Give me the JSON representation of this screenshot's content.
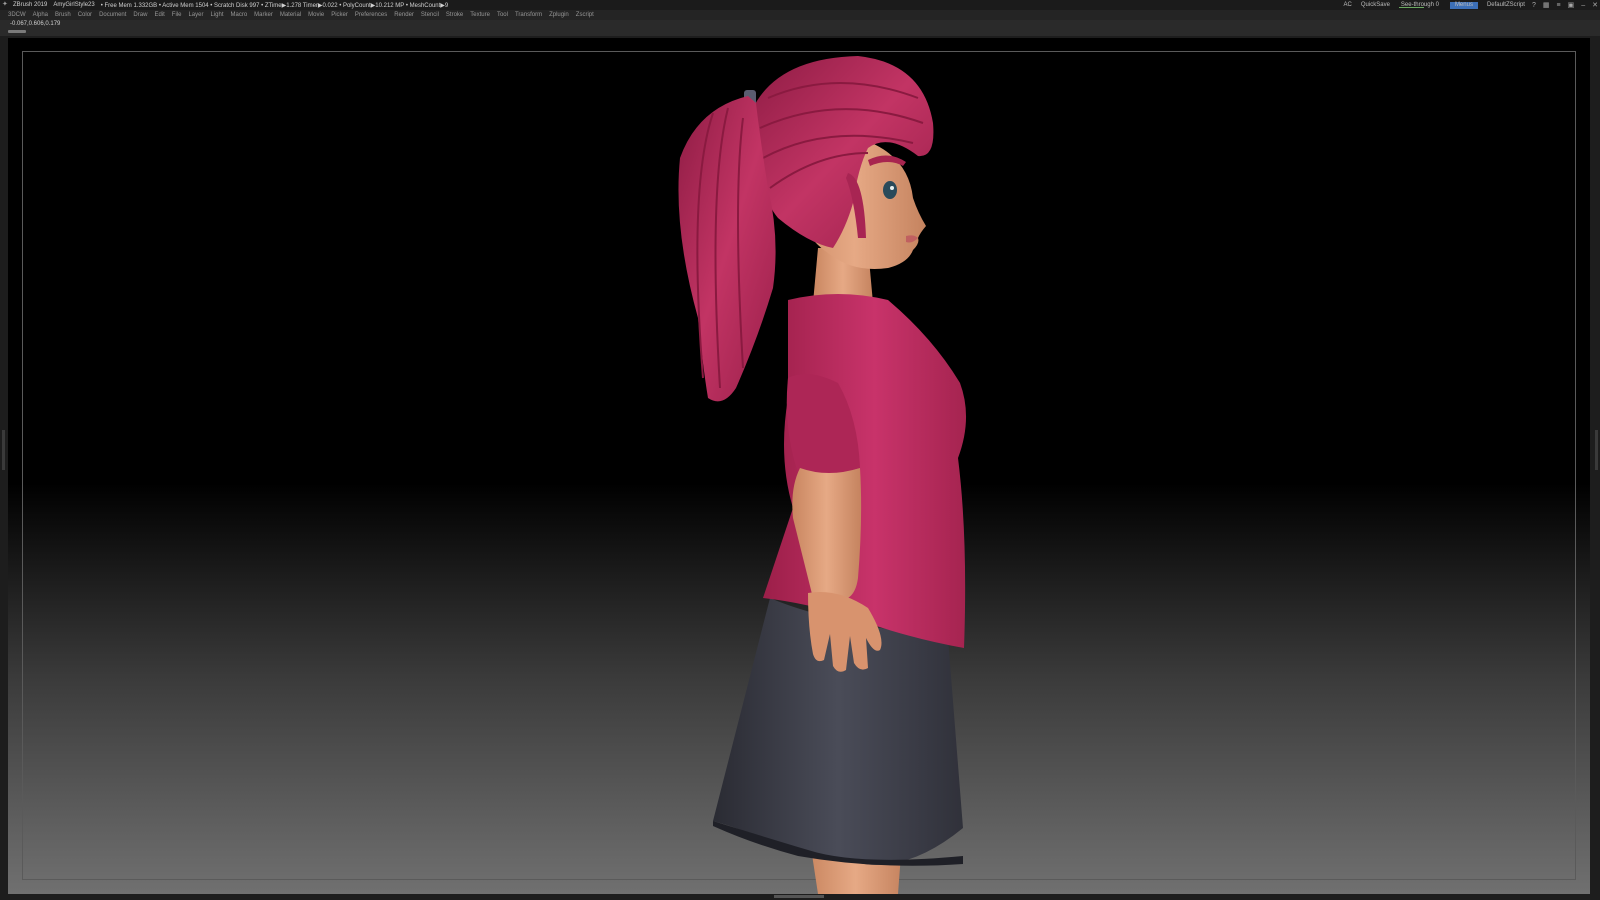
{
  "titlebar": {
    "app": "ZBrush 2019",
    "document": "AmyGirlStyle23",
    "stats": "• Free Mem 1.332GB • Active Mem 1504 • Scratch Disk 997 • ZTime▶1.278 Timer▶0.022 • PolyCount▶10.212 MP • MeshCount▶9",
    "ac": "AC",
    "quicksave": "QuickSave",
    "see_through": "See-through 0",
    "menus": "Menus",
    "script": "DefaultZScript"
  },
  "menubar": {
    "items": [
      "3DCW",
      "Alpha",
      "Brush",
      "Color",
      "Document",
      "Draw",
      "Edit",
      "File",
      "Layer",
      "Light",
      "Macro",
      "Marker",
      "Material",
      "Movie",
      "Picker",
      "Preferences",
      "Render",
      "Stencil",
      "Stroke",
      "Texture",
      "Tool",
      "Transform",
      "Zplugin",
      "Zscript"
    ]
  },
  "infobar": {
    "coords": "-0.067,0.606,0.179"
  },
  "icons": [
    "zbrush-logo-icon",
    "help-icon",
    "layout-icon",
    "script-icon",
    "lock-icon",
    "minimize-icon",
    "close-icon"
  ],
  "colors": {
    "hair": "#b8295a",
    "shirt": "#c22d5e",
    "skin": "#e0a07a",
    "skirt": "#3a3c46",
    "accent": "#3c6fb7"
  }
}
